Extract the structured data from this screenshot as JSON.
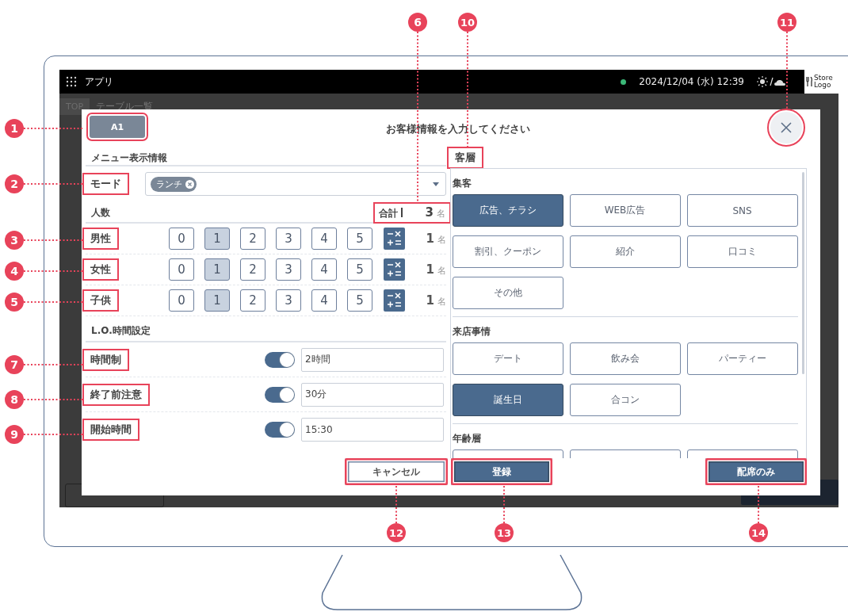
{
  "top_bar": {
    "app_label": "アプリ",
    "datetime": "2024/12/04 (水) 12:39",
    "store_logo": "Store Logo"
  },
  "background_app": {
    "top_tab": "TOP",
    "title": "テーブル一覧"
  },
  "dialog": {
    "table_button": {
      "label": "A1",
      "highlighted": true
    },
    "title": "お客様情報を入力してください",
    "close_highlighted": true,
    "menu_section": {
      "heading": "メニュー表示情報",
      "mode": {
        "label": "モード",
        "highlighted": true,
        "chips": [
          "ランチ"
        ]
      }
    },
    "party_section": {
      "heading": "人数",
      "total_label": "合計",
      "total": "3",
      "total_unit": "名",
      "total_highlighted": true,
      "rows": [
        {
          "label": "男性",
          "highlighted": true,
          "options": [
            {
              "label": "0",
              "selected": false
            },
            {
              "label": "1",
              "selected": true
            },
            {
              "label": "2",
              "selected": false
            },
            {
              "label": "3",
              "selected": false
            },
            {
              "label": "4",
              "selected": false
            },
            {
              "label": "5",
              "selected": false
            }
          ],
          "count": "1",
          "unit": "名"
        },
        {
          "label": "女性",
          "highlighted": true,
          "options": [
            {
              "label": "0",
              "selected": false
            },
            {
              "label": "1",
              "selected": true
            },
            {
              "label": "2",
              "selected": false
            },
            {
              "label": "3",
              "selected": false
            },
            {
              "label": "4",
              "selected": false
            },
            {
              "label": "5",
              "selected": false
            }
          ],
          "count": "1",
          "unit": "名"
        },
        {
          "label": "子供",
          "highlighted": true,
          "options": [
            {
              "label": "0",
              "selected": false
            },
            {
              "label": "1",
              "selected": true
            },
            {
              "label": "2",
              "selected": false
            },
            {
              "label": "3",
              "selected": false
            },
            {
              "label": "4",
              "selected": false
            },
            {
              "label": "5",
              "selected": false
            }
          ],
          "count": "1",
          "unit": "名"
        }
      ]
    },
    "lo_section": {
      "heading": "L.O.時間設定",
      "rows": [
        {
          "label": "時間制",
          "highlighted": true,
          "on": true,
          "value": "2時間"
        },
        {
          "label": "終了前注意",
          "highlighted": true,
          "on": true,
          "value": "30分"
        },
        {
          "label": "開始時間",
          "highlighted": true,
          "on": true,
          "value": "15:30"
        }
      ]
    },
    "customer_section": {
      "heading": "客層",
      "highlighted": true,
      "groups": [
        {
          "heading": "集客",
          "options": [
            {
              "label": "広告、チラシ",
              "selected": true
            },
            {
              "label": "WEB広告",
              "selected": false
            },
            {
              "label": "SNS",
              "selected": false
            },
            {
              "label": "割引、クーポン",
              "selected": false
            },
            {
              "label": "紹介",
              "selected": false
            },
            {
              "label": "口コミ",
              "selected": false
            },
            {
              "label": "その他",
              "selected": false
            }
          ]
        },
        {
          "heading": "来店事情",
          "options": [
            {
              "label": "デート",
              "selected": false
            },
            {
              "label": "飲み会",
              "selected": false
            },
            {
              "label": "パーティー",
              "selected": false
            },
            {
              "label": "誕生日",
              "selected": true
            },
            {
              "label": "合コン",
              "selected": false
            }
          ]
        },
        {
          "heading": "年齢層"
        }
      ]
    },
    "footer": {
      "buttons": [
        {
          "kind": "outline",
          "label": "キャンセル",
          "highlighted": true
        },
        {
          "kind": "primary",
          "label": "登録",
          "highlighted": true
        },
        {
          "kind": "primary",
          "label": "配席のみ",
          "highlighted": true
        }
      ]
    }
  },
  "callouts": [
    {
      "number": "1"
    },
    {
      "number": "2"
    },
    {
      "number": "3"
    },
    {
      "number": "4"
    },
    {
      "number": "5"
    },
    {
      "number": "6"
    },
    {
      "number": "7"
    },
    {
      "number": "8"
    },
    {
      "number": "9"
    },
    {
      "number": "10"
    },
    {
      "number": "11"
    },
    {
      "number": "12"
    },
    {
      "number": "13"
    },
    {
      "number": "14"
    }
  ]
}
